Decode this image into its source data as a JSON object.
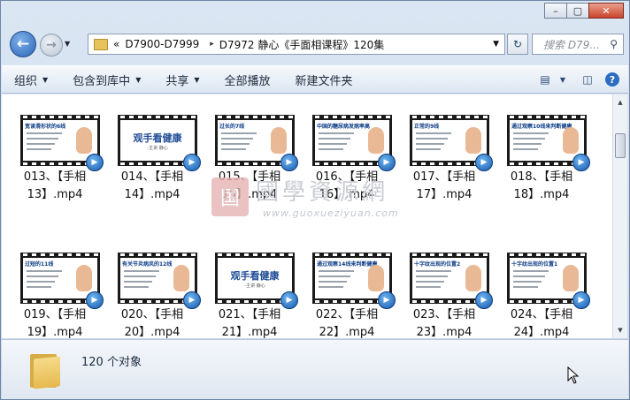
{
  "window": {
    "minimize": "–",
    "maximize": "▢",
    "close": "✕"
  },
  "nav": {
    "back_icon": "←",
    "forward_icon": "→",
    "breadcrumb_overflow": "«",
    "breadcrumb": [
      "D7900-D7999",
      "D7972 静心《手面相课程》120集"
    ],
    "crumb_sep": "▸",
    "search_placeholder": "搜索 D79...",
    "search_icon": "⚲",
    "refresh_icon": "↻"
  },
  "toolbar": {
    "organize": "组织",
    "include": "包含到库中",
    "share": "共享",
    "play_all": "全部播放",
    "new_folder": "新建文件夹",
    "view_icon": "▤",
    "pane_icon": "◫",
    "help_icon": "?"
  },
  "files": [
    {
      "name": "013、【手相13】.mp4",
      "thumb_title": "宽读滑形状的6线",
      "big": false
    },
    {
      "name": "014、【手相14】.mp4",
      "thumb_title": "观手看健康",
      "thumb_sub": "-主讲 静心",
      "big": true
    },
    {
      "name": "015、【手相15】.mp4",
      "thumb_title": "过长的7线",
      "big": false
    },
    {
      "name": "016、【手相16】.mp4",
      "thumb_title": "中国的糖尿病发病率高",
      "big": false
    },
    {
      "name": "017、【手相17】.mp4",
      "thumb_title": "正常的9线",
      "big": false
    },
    {
      "name": "018、【手相18】.mp4",
      "thumb_title": "通过观察10线来判断健康",
      "big": false
    },
    {
      "name": "019、【手相19】.mp4",
      "thumb_title": "过短的11线",
      "big": false
    },
    {
      "name": "020、【手相20】.mp4",
      "thumb_title": "有关节炎病风的12线",
      "big": false
    },
    {
      "name": "021、【手相21】.mp4",
      "thumb_title": "观手看健康",
      "thumb_sub": "-主讲 静心",
      "big": true
    },
    {
      "name": "022、【手相22】.mp4",
      "thumb_title": "通过观察14线来判断健康",
      "big": false
    },
    {
      "name": "023、【手相23】.mp4",
      "thumb_title": "十字纹出现的位置2",
      "big": false
    },
    {
      "name": "024、【手相24】.mp4",
      "thumb_title": "十字纹出现的位置1",
      "big": false
    }
  ],
  "watermark": {
    "seal": "国",
    "text": "國學資源網",
    "url": "www.guoxueziyuan.com"
  },
  "status": {
    "count": "120 个对象"
  },
  "colors": {
    "accent": "#2a64b5",
    "toolbar_bg": "#dce6f2"
  }
}
